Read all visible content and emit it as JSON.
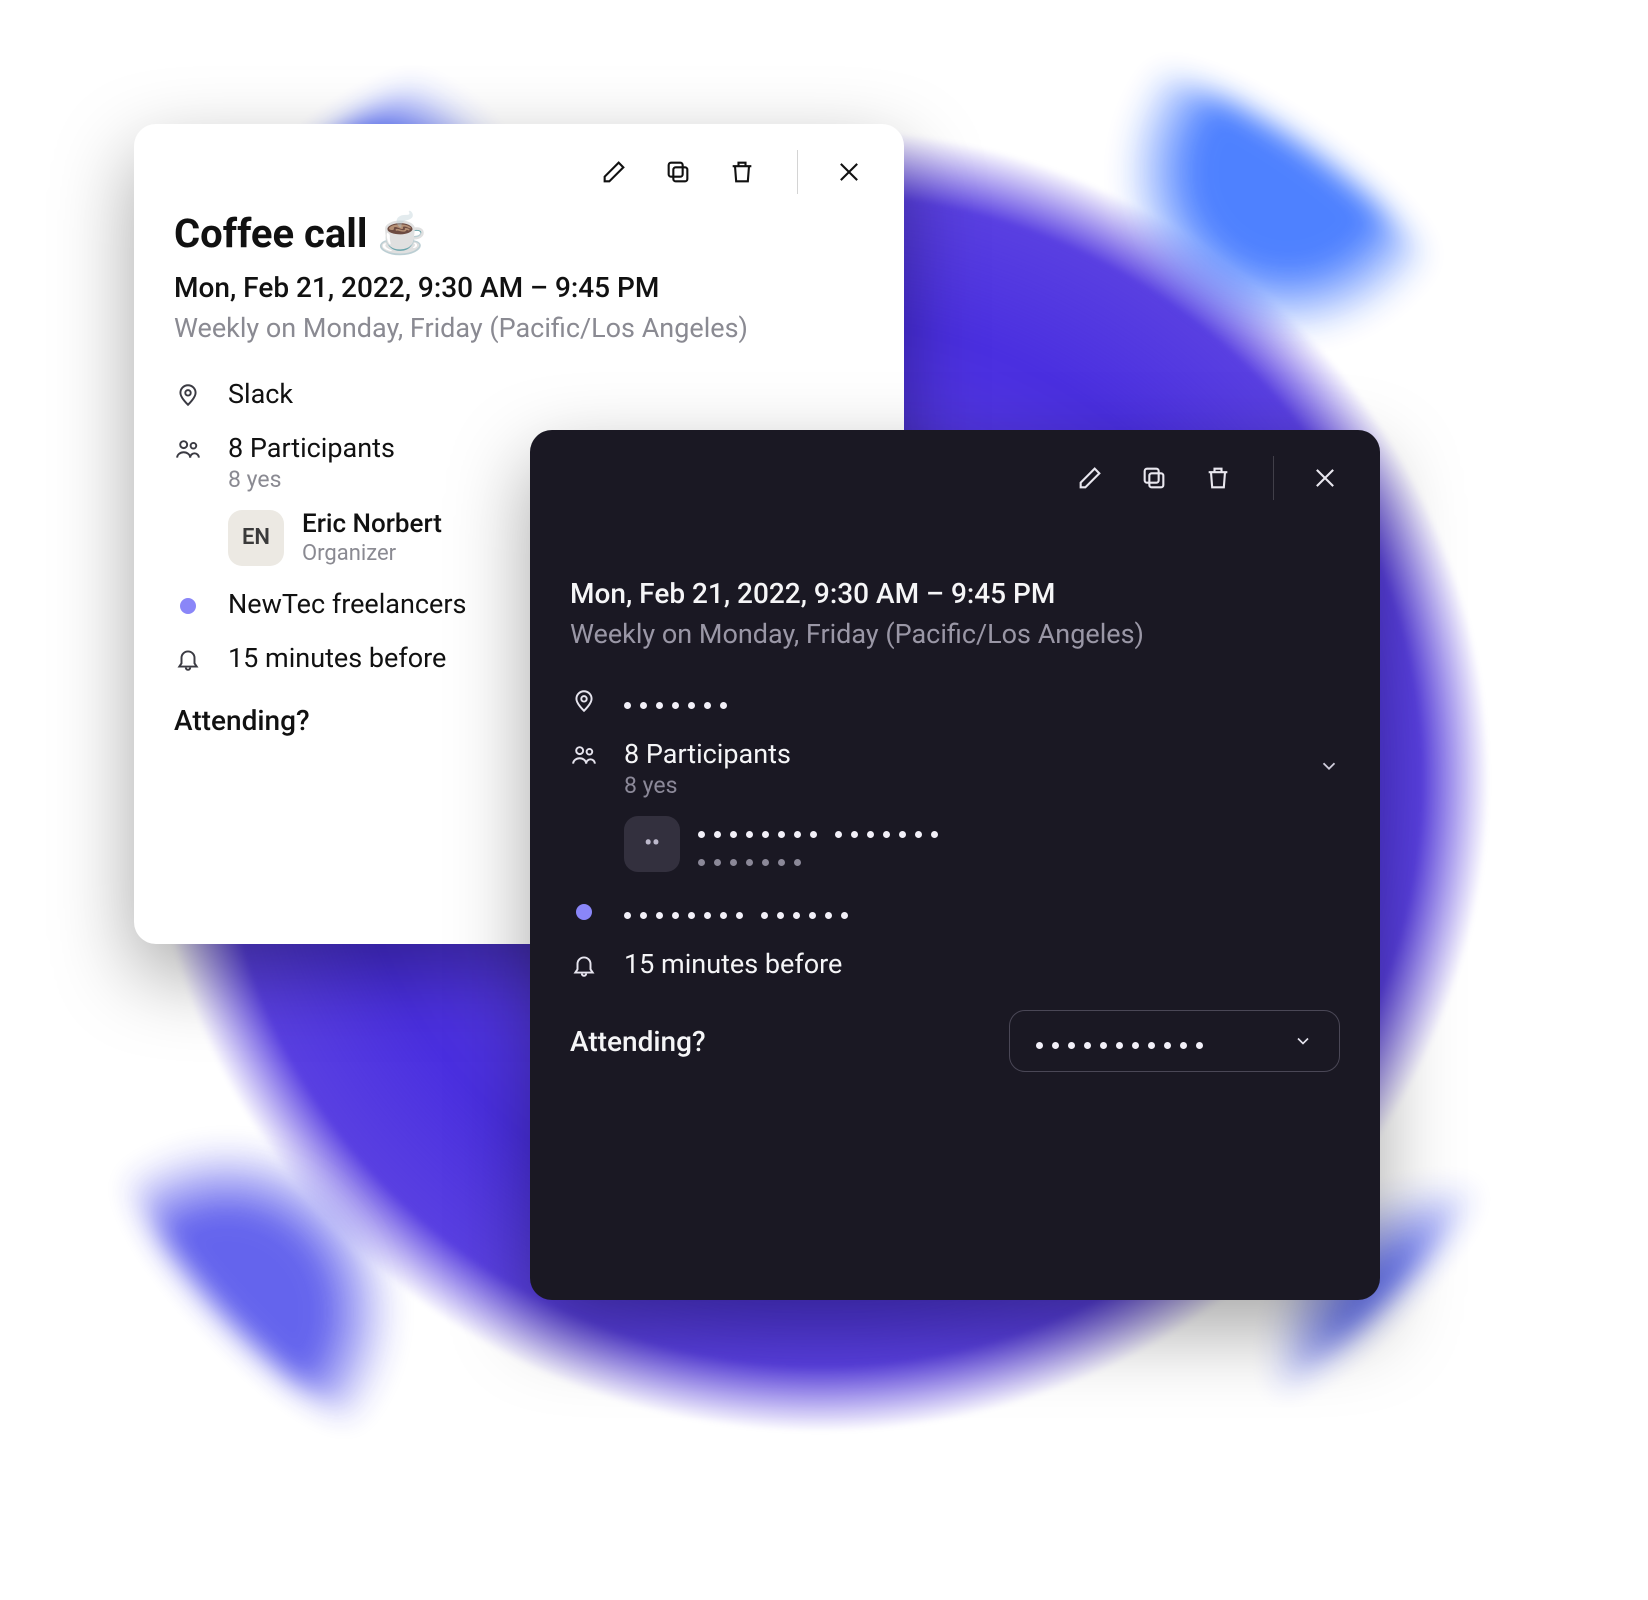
{
  "light": {
    "title": "Coffee call ☕",
    "datetime": "Mon, Feb 21, 2022, 9:30 AM – 9:45 PM",
    "recurrence": "Weekly on Monday, Friday (Pacific/Los Angeles)",
    "location": "Slack",
    "participants_label": "8 Participants",
    "participants_yes": "8 yes",
    "organizer_initials": "EN",
    "organizer_name": "Eric Norbert",
    "organizer_role": "Organizer",
    "calendar": "NewTec freelancers",
    "calendar_color": "#8a86f8",
    "reminder": "15 minutes before",
    "attending_label": "Attending?"
  },
  "dark": {
    "title_redacted_groups": [
      11,
      5
    ],
    "datetime": "Mon, Feb 21, 2022, 9:30 AM – 9:45 PM",
    "recurrence": "Weekly on Monday, Friday (Pacific/Los Angeles)",
    "location_redacted": 7,
    "participants_label": "8 Participants",
    "participants_yes": "8 yes",
    "organizer_initials": "••",
    "organizer_name_redacted_groups": [
      8,
      7
    ],
    "organizer_role_redacted": 7,
    "calendar_redacted_groups": [
      8,
      6
    ],
    "calendar_color": "#8a86f8",
    "reminder": "15 minutes before",
    "attending_label": "Attending?",
    "rsvp_redacted": 11
  }
}
